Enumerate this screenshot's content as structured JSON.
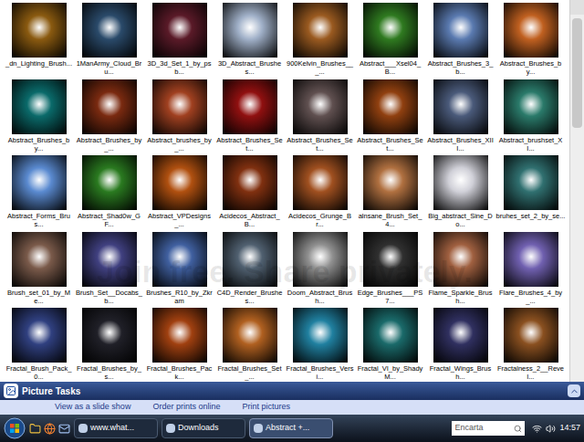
{
  "thumbnails": [
    {
      "label": "_dn_Lighting_Brush...",
      "color": "#8a5a10"
    },
    {
      "label": "1ManArmy_Cloud_Bru...",
      "color": "#2a4a6a"
    },
    {
      "label": "3D_3d_Set_1_by_psb...",
      "color": "#5a1a28"
    },
    {
      "label": "3D_Abstract_Brushes...",
      "color": "#a0b0c8"
    },
    {
      "label": "900Kelvin_Brushes___...",
      "color": "#9a5a20"
    },
    {
      "label": "Abstract___Xsel04_B...",
      "color": "#2f7a20"
    },
    {
      "label": "Abstract_Brushes_3_b...",
      "color": "#5a7ab0"
    },
    {
      "label": "Abstract_Brushes_by...",
      "color": "#c06020"
    },
    {
      "label": "Abstract_Brushes_by...",
      "color": "#0a6a6a"
    },
    {
      "label": "Abstract_Brushes_by_...",
      "color": "#7a2a10"
    },
    {
      "label": "Abstract_brushes_by_...",
      "color": "#a04020"
    },
    {
      "label": "Abstract_Brushes_Set...",
      "color": "#901010"
    },
    {
      "label": "Abstract_Brushes_Set...",
      "color": "#605050"
    },
    {
      "label": "Abstract_Brushes_Set...",
      "color": "#904010"
    },
    {
      "label": "Abstract_Brushes_XIII...",
      "color": "#4a5a7a"
    },
    {
      "label": "Abstract_brushset_XI...",
      "color": "#2a7a6a"
    },
    {
      "label": "Abstract_Forms_Brus...",
      "color": "#5a8ad0"
    },
    {
      "label": "Abstract_Shad0w_GF...",
      "color": "#2a7a20"
    },
    {
      "label": "Abstract_VPDesigns_...",
      "color": "#b05010"
    },
    {
      "label": "Acidecos_Abstract_B...",
      "color": "#803010"
    },
    {
      "label": "Acidecos_Grunge_Br...",
      "color": "#a05020"
    },
    {
      "label": "alnsane_Brush_Set_4...",
      "color": "#b07040"
    },
    {
      "label": "Big_abstract_Sine_Do...",
      "color": "#d0d0d8"
    },
    {
      "label": "bruhes_set_2_by_se...",
      "color": "#307070"
    },
    {
      "label": "Brush_set_01_by_Me...",
      "color": "#7a5a4a"
    },
    {
      "label": "Brush_Set__Docabs_b...",
      "color": "#404080"
    },
    {
      "label": "Brushes_R10_by_Zkram",
      "color": "#4060a0"
    },
    {
      "label": "C4D_Render_Brushes...",
      "color": "#506070"
    },
    {
      "label": "Doom_Abstract_Brush...",
      "color": "#909090"
    },
    {
      "label": "Edge_Brushes___PS7...",
      "color": "#303030"
    },
    {
      "label": "Flame_Sparkle_Brush...",
      "color": "#a06040"
    },
    {
      "label": "Flare_Brushes_4_by_...",
      "color": "#7060b0"
    },
    {
      "label": "Fractal_Brush_Pack_0...",
      "color": "#304080"
    },
    {
      "label": "Fractal_Brushes_by_s...",
      "color": "#202028"
    },
    {
      "label": "Fractal_Brushes_Pack...",
      "color": "#a04010"
    },
    {
      "label": "Fractal_Brushes_Set_...",
      "color": "#b06020"
    },
    {
      "label": "Fractal_Brushes_Versi...",
      "color": "#2080a0"
    },
    {
      "label": "Fractal_VI_by_ShadyM...",
      "color": "#1a6a6a"
    },
    {
      "label": "Fractal_Wings_Brush...",
      "color": "#303060"
    },
    {
      "label": "Fractalness_2__Revel...",
      "color": "#8a5020"
    }
  ],
  "watermark": {
    "text": "Join free. Share privately."
  },
  "picture_tasks": {
    "title": "Picture Tasks",
    "expanded": true
  },
  "tasks": [
    "View as a slide show",
    "Order prints online",
    "Print pictures"
  ],
  "taskbar": {
    "buttons": [
      {
        "label": "www.what...",
        "selected": false
      },
      {
        "label": "Downloads",
        "selected": false
      },
      {
        "label": "Abstract +...",
        "selected": true
      }
    ],
    "search": {
      "placeholder": "Encarta"
    },
    "clock": "14:57"
  }
}
